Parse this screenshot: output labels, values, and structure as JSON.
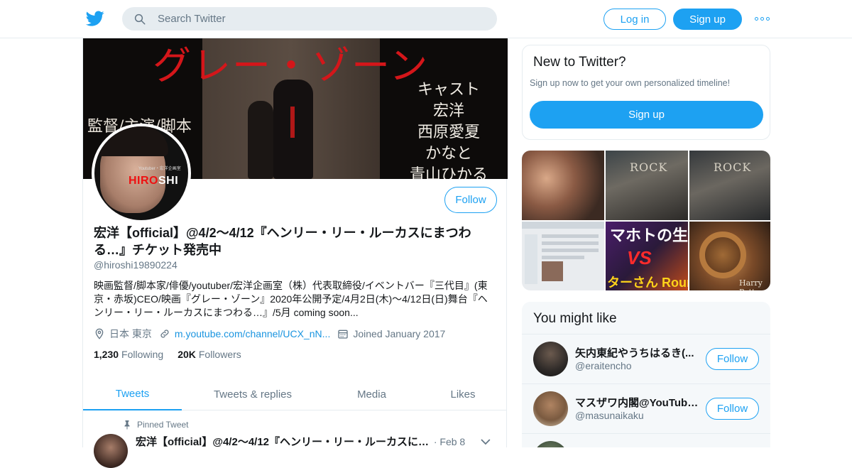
{
  "nav": {
    "search_placeholder": "Search Twitter",
    "login_label": "Log in",
    "signup_label": "Sign up",
    "more_icon": "more-dots-icon",
    "logo_icon": "twitter-bird-icon",
    "accent_color": "#1da1f2"
  },
  "banner": {
    "title": "グレー・ゾーン",
    "left_text": "監督/主演/脚本",
    "cast": [
      "キャスト",
      "宏洋",
      "西原愛夏",
      "かなと",
      "青山ひかる"
    ]
  },
  "avatar": {
    "brand_a": "HIRO",
    "brand_b": "SHI",
    "subtitle": "Youtuber・宏洋企画室"
  },
  "profile": {
    "follow_label": "Follow",
    "name": "宏洋【official】@4/2〜4/12『ヘンリー・リー・ルーカスにまつわる…』チケット発売中",
    "handle": "@hiroshi19890224",
    "bio": "映画監督/脚本家/俳優/youtuber/宏洋企画室（株）代表取締役/イベントバー『三代目』(東京・赤坂)CEO/映画『グレー・ゾーン』2020年公開予定/4月2日(木)〜4/12日(日)舞台『ヘンリー・リー・ルーカスにまつわる…』/5月 coming soon...",
    "location": "日本 東京",
    "url": "m.youtube.com/channel/UCX_nN...",
    "joined": "Joined January 2017",
    "following_count": "1,230",
    "following_label": "Following",
    "followers_count": "20K",
    "followers_label": "Followers"
  },
  "tabs": [
    {
      "label": "Tweets",
      "active": true
    },
    {
      "label": "Tweets & replies",
      "active": false
    },
    {
      "label": "Media",
      "active": false
    },
    {
      "label": "Likes",
      "active": false
    }
  ],
  "pinned": {
    "label": "Pinned Tweet",
    "name": "宏洋【official】@4/2〜4/12『ヘンリー・リー・ルーカスにま...",
    "date": "· Feb 8"
  },
  "new_to_twitter": {
    "heading": "New to Twitter?",
    "text": "Sign up now to get your own personalized timeline!",
    "button": "Sign up"
  },
  "media_tiles": {
    "rock": "ROCK",
    "mahoto": "マホトの生",
    "vs": "VS",
    "round": "ターさん Roun",
    "potter": "Harry Potter"
  },
  "you_might_like": {
    "heading": "You might like",
    "follow_label": "Follow",
    "items": [
      {
        "name": "矢内東紀やうちはるき(...",
        "handle": "@eraitencho"
      },
      {
        "name": "マスザワ内閣@YouTube...",
        "handle": "@masunaikaku"
      }
    ]
  }
}
